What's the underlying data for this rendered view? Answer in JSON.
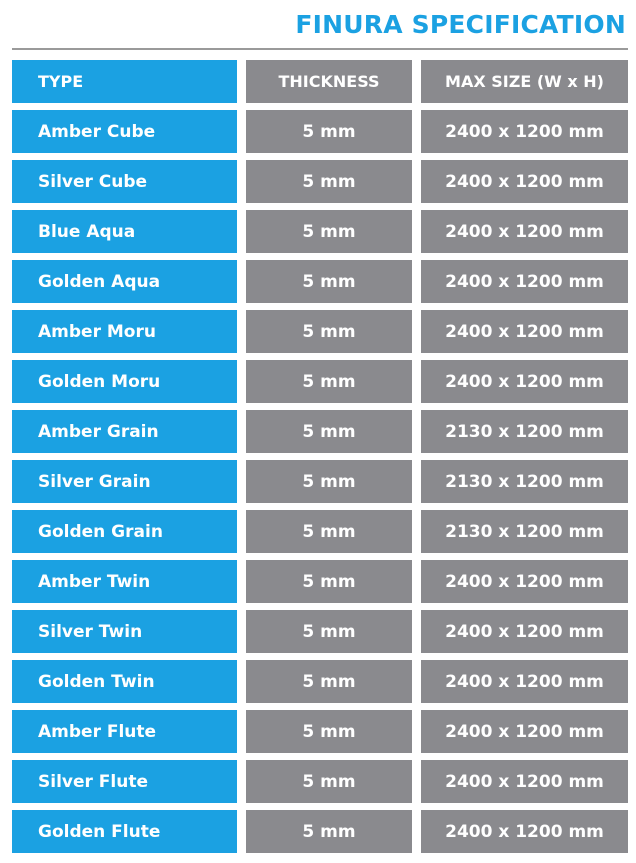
{
  "title": "FINURA SPECIFICATION",
  "colors": {
    "accent": "#1ba1e2",
    "grey": "#8a8a8e",
    "rule": "#9a9a9a"
  },
  "headers": {
    "type": "TYPE",
    "thickness": "THICKNESS",
    "max_size": "MAX SIZE (W x H)"
  },
  "rows": [
    {
      "type": "Amber Cube",
      "thickness": "5 mm",
      "max_size": "2400 x 1200 mm"
    },
    {
      "type": "Silver Cube",
      "thickness": "5 mm",
      "max_size": "2400 x 1200 mm"
    },
    {
      "type": "Blue Aqua",
      "thickness": "5 mm",
      "max_size": "2400 x 1200 mm"
    },
    {
      "type": "Golden Aqua",
      "thickness": "5 mm",
      "max_size": "2400 x 1200 mm"
    },
    {
      "type": "Amber Moru",
      "thickness": "5 mm",
      "max_size": "2400 x 1200 mm"
    },
    {
      "type": "Golden Moru",
      "thickness": "5 mm",
      "max_size": "2400 x 1200 mm"
    },
    {
      "type": "Amber Grain",
      "thickness": "5 mm",
      "max_size": "2130 x 1200 mm"
    },
    {
      "type": "Silver Grain",
      "thickness": "5 mm",
      "max_size": "2130 x 1200 mm"
    },
    {
      "type": "Golden Grain",
      "thickness": "5 mm",
      "max_size": "2130 x 1200 mm"
    },
    {
      "type": "Amber Twin",
      "thickness": "5 mm",
      "max_size": "2400 x 1200 mm"
    },
    {
      "type": "Silver Twin",
      "thickness": "5 mm",
      "max_size": "2400 x 1200 mm"
    },
    {
      "type": "Golden Twin",
      "thickness": "5 mm",
      "max_size": "2400 x 1200 mm"
    },
    {
      "type": "Amber Flute",
      "thickness": "5 mm",
      "max_size": "2400 x 1200 mm"
    },
    {
      "type": "Silver Flute",
      "thickness": "5 mm",
      "max_size": "2400 x 1200 mm"
    },
    {
      "type": "Golden Flute",
      "thickness": "5 mm",
      "max_size": "2400 x 1200 mm"
    }
  ]
}
